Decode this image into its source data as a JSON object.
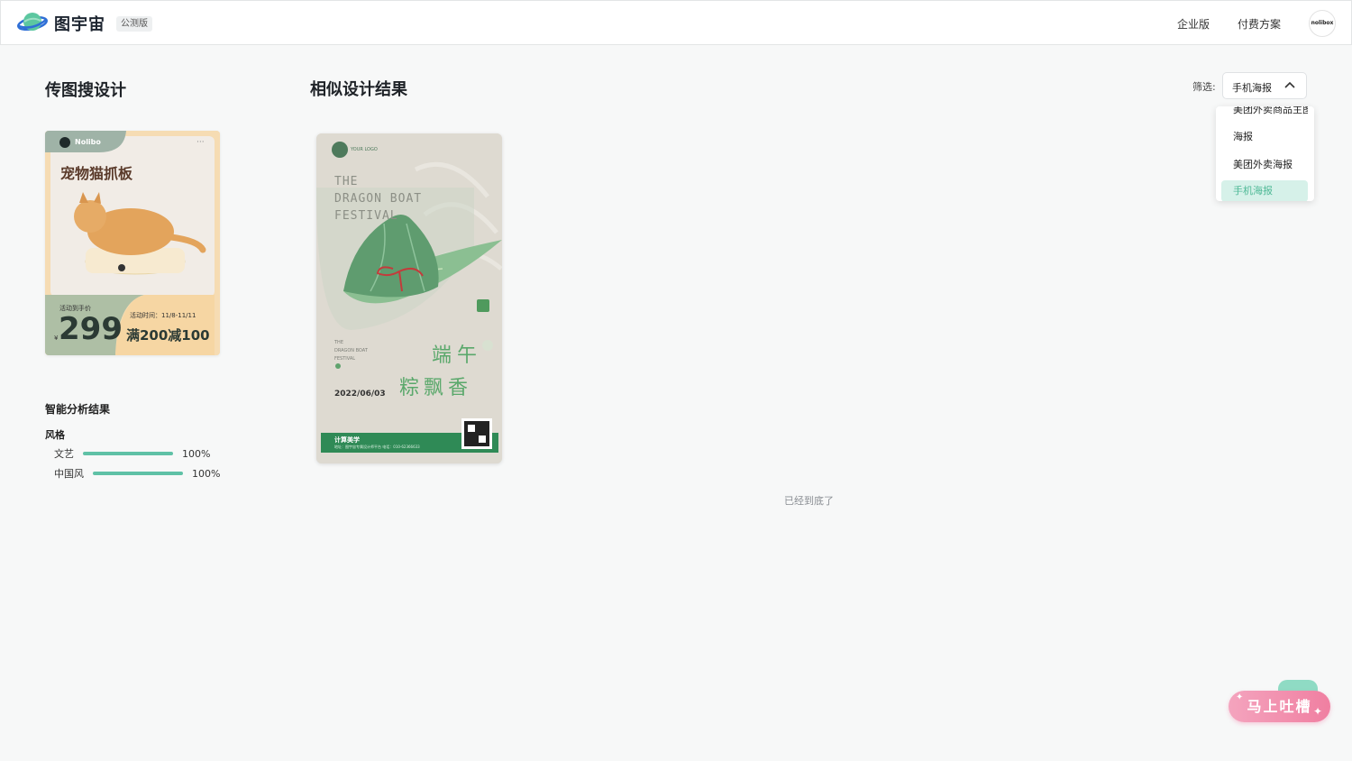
{
  "header": {
    "brand": "图宇宙",
    "beta_badge": "公测版",
    "nav": [
      "企业版",
      "付费方案"
    ],
    "avatar_text": "nolibox"
  },
  "left": {
    "title": "传图搜设计",
    "upload_poster": {
      "brand": "Nolibo",
      "dots": "···",
      "title": "宠物猫抓板",
      "price_label": "活动到手价",
      "currency": "¥",
      "price": "299",
      "time": "活动时间：11/8-11/11",
      "promo": "满200减100"
    },
    "analysis": {
      "title": "智能分析结果",
      "style_title": "风格",
      "tags": [
        {
          "label": "文艺",
          "percent": "100%",
          "value": 1.0
        },
        {
          "label": "中国风",
          "percent": "100%",
          "value": 1.0
        }
      ]
    }
  },
  "main": {
    "title": "相似设计结果",
    "result_poster": {
      "logo_text": "YOUR LOGO",
      "en_title": [
        "THE",
        "DRAGON BOAT",
        "FESTIVAL"
      ],
      "small_en": [
        "THE",
        "DRAGON BOAT",
        "FESTIVAL"
      ],
      "date": "2022/06/03",
      "cn_line1": "端午",
      "cn_line2": "粽飘香",
      "footer_brand": "计算美学",
      "footer_info": "地址：图宇宙专属设计师平台   电话：010-62366633"
    },
    "bottom_msg": "已经到底了"
  },
  "filter": {
    "label": "筛选:",
    "selected": "手机海报",
    "options": [
      "美团外卖商品主图",
      "海报",
      "美团外卖海报",
      "手机海报"
    ]
  },
  "feedback": {
    "label": "马上吐槽"
  },
  "colors": {
    "accent": "#5fc1a6",
    "active_bg": "#d6f1e9",
    "feedback_pink": "#f07fa1"
  }
}
